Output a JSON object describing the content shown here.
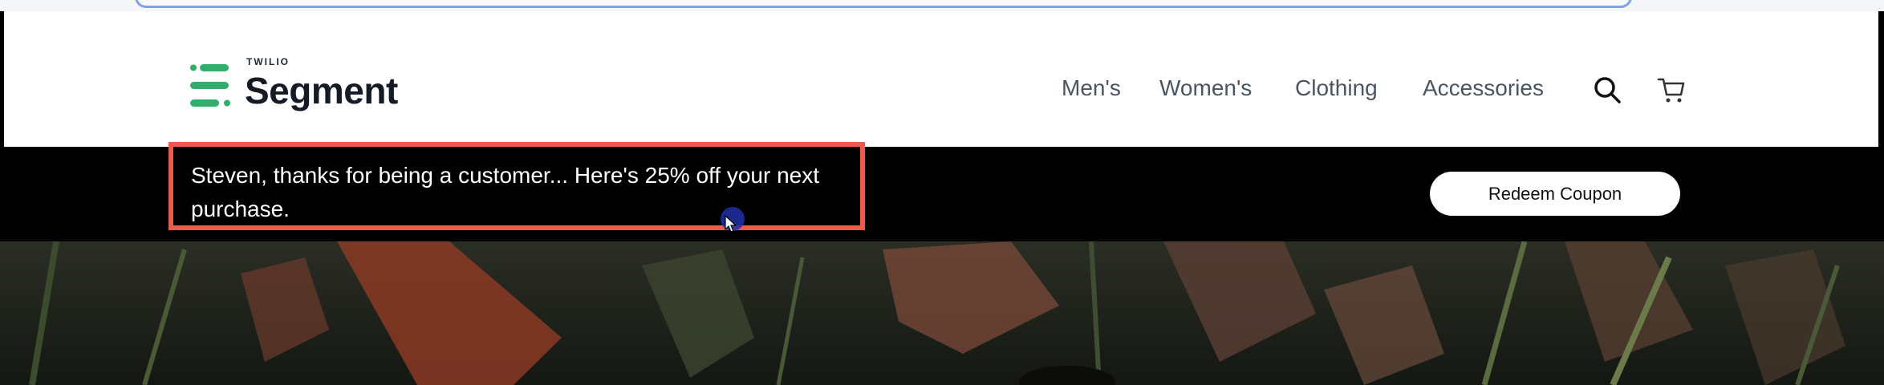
{
  "header": {
    "logo": {
      "brand_top": "TWILIO",
      "brand_main": "Segment"
    },
    "nav": [
      "Men's",
      "Women's",
      "Clothing",
      "Accessories"
    ],
    "icons": [
      "search-icon",
      "cart-icon"
    ]
  },
  "promo": {
    "message": "Steven, thanks for being a customer... Here's 25% off your next purchase.",
    "button_label": "Redeem Coupon",
    "highlight_color": "#ef5a4f"
  },
  "colors": {
    "accent": "#2fae6c",
    "promo_bg": "#000000"
  }
}
